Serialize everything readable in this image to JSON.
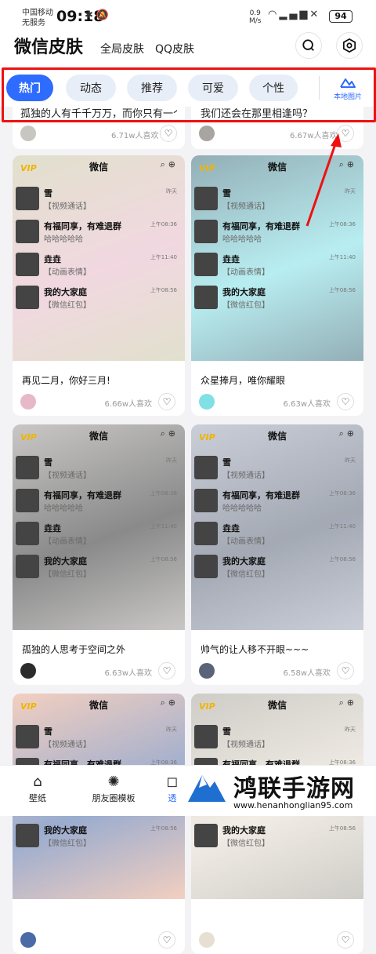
{
  "status": {
    "carrier1": "中国移动",
    "carrier2": "无服务",
    "time": "09:18",
    "speed_value": "0.9",
    "speed_unit": "M/s",
    "battery": "94"
  },
  "header": {
    "title": "微信皮肤",
    "nav": [
      "全局皮肤",
      "QQ皮肤"
    ],
    "search_icon": "search-icon",
    "settings_icon": "settings-hex-icon"
  },
  "tabs": [
    "热门",
    "动态",
    "推荐",
    "可爱",
    "个性"
  ],
  "active_tab": "热门",
  "local_pic": "本地图片",
  "top_partial": [
    {
      "text": "孤独的人有千千万万，而你只有一个",
      "likes": "6.71w人喜欢"
    },
    {
      "text": "我们还会在那里相逢吗？",
      "likes": "6.67w人喜欢"
    }
  ],
  "preview": {
    "app": "微信",
    "vip": "VIP",
    "chats": [
      {
        "name": "雪",
        "msg": "【视频通话】",
        "time": "昨天"
      },
      {
        "name": "有福同享，有难退群",
        "msg": "哈哈哈哈哈",
        "time": "上午08:36"
      },
      {
        "name": "垚垚",
        "msg": "【动画表情】",
        "time": "上午11:40"
      },
      {
        "name": "我的大家庭",
        "msg": "【微信红包】",
        "time": "上午08:56"
      }
    ]
  },
  "cards": [
    {
      "title": "再见二月，你好三月!",
      "likes": "6.66w人喜欢",
      "bg": "#c9c7a4",
      "accent": "#e7b9c8"
    },
    {
      "title": "众星捧月，唯你耀眼",
      "likes": "6.63w人喜欢",
      "bg": "#3d6e7c",
      "accent": "#7fe0e6"
    },
    {
      "title": "孤独的人思考于空间之外",
      "likes": "6.63w人喜欢",
      "bg": "#9d9a98",
      "accent": "#2c2c2c"
    },
    {
      "title": "帅气的让人移不开眼~~~",
      "likes": "6.58w人喜欢",
      "bg": "#9fa7b8",
      "accent": "#5a6478"
    },
    {
      "title": "",
      "likes": "",
      "bg": "#e9a98e",
      "accent": "#4a6aa8"
    },
    {
      "title": "",
      "likes": "",
      "bg": "#a8a49a",
      "accent": "#e7dfd2"
    }
  ],
  "bottom_nav": [
    "壁纸",
    "朋友圈模板",
    "透"
  ],
  "watermark": {
    "title": "鸿联手游网",
    "url": "www.henanhonglian95.com"
  },
  "colors": {
    "accent": "#2e6bff",
    "highlight": "#e11111"
  }
}
